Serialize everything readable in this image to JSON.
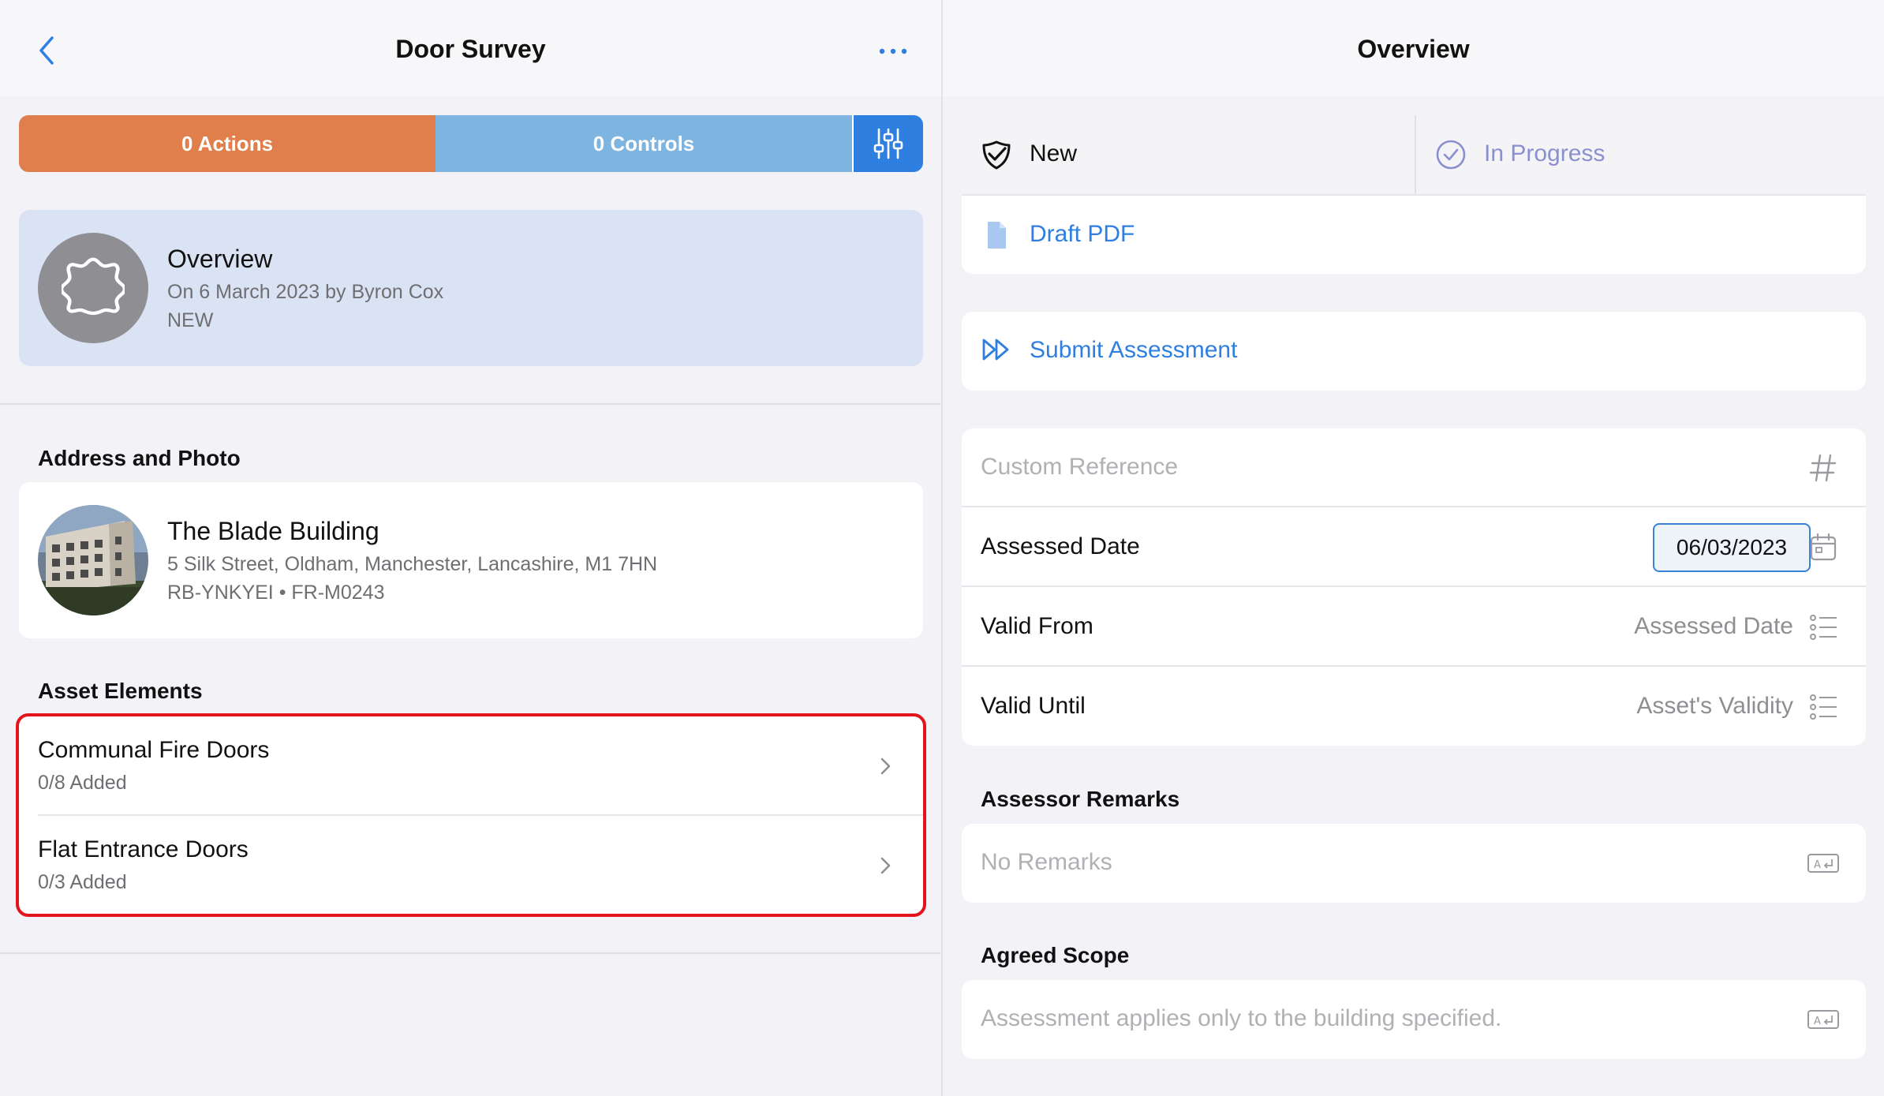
{
  "left": {
    "title": "Door Survey",
    "back_icon": "chevron-left-icon",
    "more_icon": "ellipsis-icon",
    "action_bar": {
      "actions_label": "0 Actions",
      "controls_label": "0 Controls",
      "filter_icon": "sliders-icon",
      "colors": {
        "actions": "#e07e4c",
        "controls": "#7eb4e0",
        "filter": "#2f7fe0"
      }
    },
    "overview": {
      "title": "Overview",
      "subtitle": "On 6 March 2023 by Byron Cox",
      "status": "NEW",
      "icon": "gear-placeholder-icon"
    },
    "address_section": {
      "header": "Address and Photo",
      "name": "The Blade Building",
      "address": "5 Silk Street, Oldham, Manchester, Lancashire, M1 7HN",
      "refs": "RB-YNKYEI • FR-M0243"
    },
    "asset_section": {
      "header": "Asset Elements",
      "items": [
        {
          "title": "Communal Fire Doors",
          "subtitle": "0/8 Added"
        },
        {
          "title": "Flat Entrance Doors",
          "subtitle": "0/3 Added"
        }
      ],
      "highlight_color": "#e3141c"
    }
  },
  "right": {
    "title": "Overview",
    "status": {
      "new_label": "New",
      "in_progress_label": "In Progress",
      "draft_pdf_label": "Draft PDF"
    },
    "submit_label": "Submit Assessment",
    "form": {
      "custom_reference_placeholder": "Custom Reference",
      "assessed_date_label": "Assessed Date",
      "assessed_date_value": "06/03/2023",
      "valid_from_label": "Valid From",
      "valid_from_value": "Assessed Date",
      "valid_until_label": "Valid Until",
      "valid_until_value": "Asset's Validity"
    },
    "remarks": {
      "header": "Assessor Remarks",
      "placeholder": "No Remarks"
    },
    "scope": {
      "header": "Agreed Scope",
      "placeholder": "Assessment applies only to the building specified."
    }
  }
}
